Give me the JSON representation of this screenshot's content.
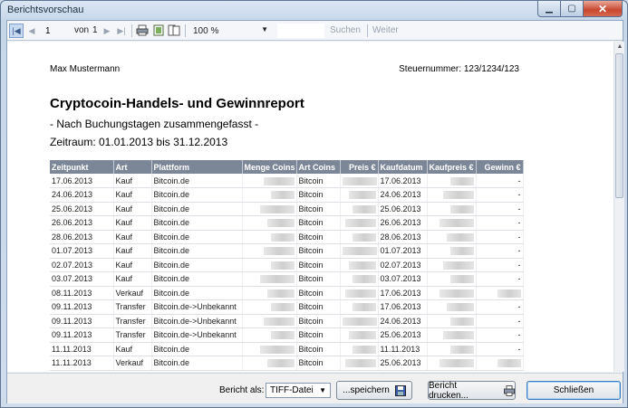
{
  "window": {
    "title": "Berichtsvorschau"
  },
  "toolbar": {
    "page_value": "1",
    "of_label": "von",
    "page_total": "1",
    "zoom": "100 %",
    "search_label": "Suchen",
    "next_label": "Weiter"
  },
  "report": {
    "name": "Max Mustermann",
    "tax_number": "Steuernummer: 123/1234/123",
    "title": "Cryptocoin-Handels- und Gewinnreport",
    "subtitle": "- Nach Buchungstagen zusammengefasst -",
    "range": "Zeitraum: 01.01.2013 bis 31.12.2013",
    "columns": [
      "Zeitpunkt",
      "Art",
      "Plattform",
      "Menge Coins",
      "Art Coins",
      "Preis €",
      "Kaufdatum",
      "Kaufpreis €",
      "Gewinn €"
    ],
    "rows": [
      {
        "date": "17.06.2013",
        "type": "Kauf",
        "platform": "Bitcoin.de",
        "coin": "Bitcoin",
        "buydate": "17.06.2013",
        "profit": "-"
      },
      {
        "date": "24.06.2013",
        "type": "Kauf",
        "platform": "Bitcoin.de",
        "coin": "Bitcoin",
        "buydate": "24.06.2013",
        "profit": "-"
      },
      {
        "date": "25.06.2013",
        "type": "Kauf",
        "platform": "Bitcoin.de",
        "coin": "Bitcoin",
        "buydate": "25.06.2013",
        "profit": "-"
      },
      {
        "date": "26.06.2013",
        "type": "Kauf",
        "platform": "Bitcoin.de",
        "coin": "Bitcoin",
        "buydate": "26.06.2013",
        "profit": "-"
      },
      {
        "date": "28.06.2013",
        "type": "Kauf",
        "platform": "Bitcoin.de",
        "coin": "Bitcoin",
        "buydate": "28.06.2013",
        "profit": "-"
      },
      {
        "date": "01.07.2013",
        "type": "Kauf",
        "platform": "Bitcoin.de",
        "coin": "Bitcoin",
        "buydate": "01.07.2013",
        "profit": "-"
      },
      {
        "date": "02.07.2013",
        "type": "Kauf",
        "platform": "Bitcoin.de",
        "coin": "Bitcoin",
        "buydate": "02.07.2013",
        "profit": "-"
      },
      {
        "date": "03.07.2013",
        "type": "Kauf",
        "platform": "Bitcoin.de",
        "coin": "Bitcoin",
        "buydate": "03.07.2013",
        "profit": "-"
      },
      {
        "date": "08.11.2013",
        "type": "Verkauf",
        "platform": "Bitcoin.de",
        "coin": "Bitcoin",
        "buydate": "17.06.2013",
        "profit": ""
      },
      {
        "date": "09.11.2013",
        "type": "Transfer",
        "platform": "Bitcoin.de->Unbekannt",
        "coin": "Bitcoin",
        "buydate": "17.06.2013",
        "profit": "-"
      },
      {
        "date": "09.11.2013",
        "type": "Transfer",
        "platform": "Bitcoin.de->Unbekannt",
        "coin": "Bitcoin",
        "buydate": "24.06.2013",
        "profit": "-"
      },
      {
        "date": "09.11.2013",
        "type": "Transfer",
        "platform": "Bitcoin.de->Unbekannt",
        "coin": "Bitcoin",
        "buydate": "25.06.2013",
        "profit": "-"
      },
      {
        "date": "11.11.2013",
        "type": "Kauf",
        "platform": "Bitcoin.de",
        "coin": "Bitcoin",
        "buydate": "11.11.2013",
        "profit": "-"
      },
      {
        "date": "11.11.2013",
        "type": "Verkauf",
        "platform": "Bitcoin.de",
        "coin": "Bitcoin",
        "buydate": "25.06.2013",
        "profit": ""
      }
    ]
  },
  "bottom": {
    "format_label": "Bericht als:",
    "format_value": "TIFF-Datei",
    "save_label": "...speichern",
    "print_label": "Bericht drucken...",
    "close_label": "Schließen"
  }
}
